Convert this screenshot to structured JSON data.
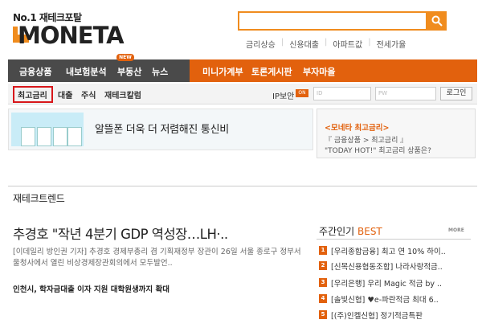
{
  "header": {
    "tagline": "No.1 재테크포탈",
    "logo_text": "MONETA",
    "search_placeholder": "",
    "top_links": [
      "금리상승",
      "신용대출",
      "아파트값",
      "전세가율"
    ]
  },
  "nav": {
    "items": [
      "금융상품",
      "내보험분석",
      "부동산",
      "뉴스",
      "미니가계부",
      "토론게시판",
      "부자마을"
    ],
    "new_badge": "NEW"
  },
  "subnav": {
    "items": [
      "최고금리",
      "대출",
      "주식",
      "재테크칼럼"
    ],
    "ip_label": "IP보안",
    "ip_badge": "ON",
    "id_placeholder": "ID",
    "pw_placeholder": "PW",
    "login_label": "로그인"
  },
  "banner": {
    "text": "알뜰폰 더욱 더 저렴해진 통신비",
    "sidebox_title": "<모네타 최고금리>",
    "sidebox_line1": "『 금융상품 > 최고금리 』",
    "sidebox_line2": "\"TODAY HOT!\" 최고금리 상품은?"
  },
  "trend": {
    "section_title": "재테크트렌드",
    "headline": "추경호 \"작년 4분기 GDP 역성장…LH·..",
    "summary": "[이데일리 방인권 기자] 추경호 경제부총리 겸 기획재정부 장관이 26일 서울 종로구 정부서울청사에서 열린 비상경제장관회의에서 모두발언..",
    "sub_headline": "인천시, 학자금대출 이자 지원 대학원생까지 확대"
  },
  "best": {
    "title_prefix": "주간인기",
    "title_accent": "BEST",
    "more_label": "MORE",
    "items": [
      {
        "num": "1",
        "text": "[우리종합금융] 최고 연 10% 하이.."
      },
      {
        "num": "2",
        "text": "[신목신용협동조합] 나라사랑적금.."
      },
      {
        "num": "3",
        "text": "[우리은행] 우리 Magic 적금 by .."
      },
      {
        "num": "4",
        "text": "[솔빛신협] ♥e-파란적금 최대 6.."
      },
      {
        "num": "5",
        "text": "[(주)인켈신협] 정기적금특판"
      }
    ]
  },
  "colors": {
    "accent": "#e2610d",
    "nav_dark": "#4a4a4a",
    "highlight_red": "#d8171b"
  }
}
